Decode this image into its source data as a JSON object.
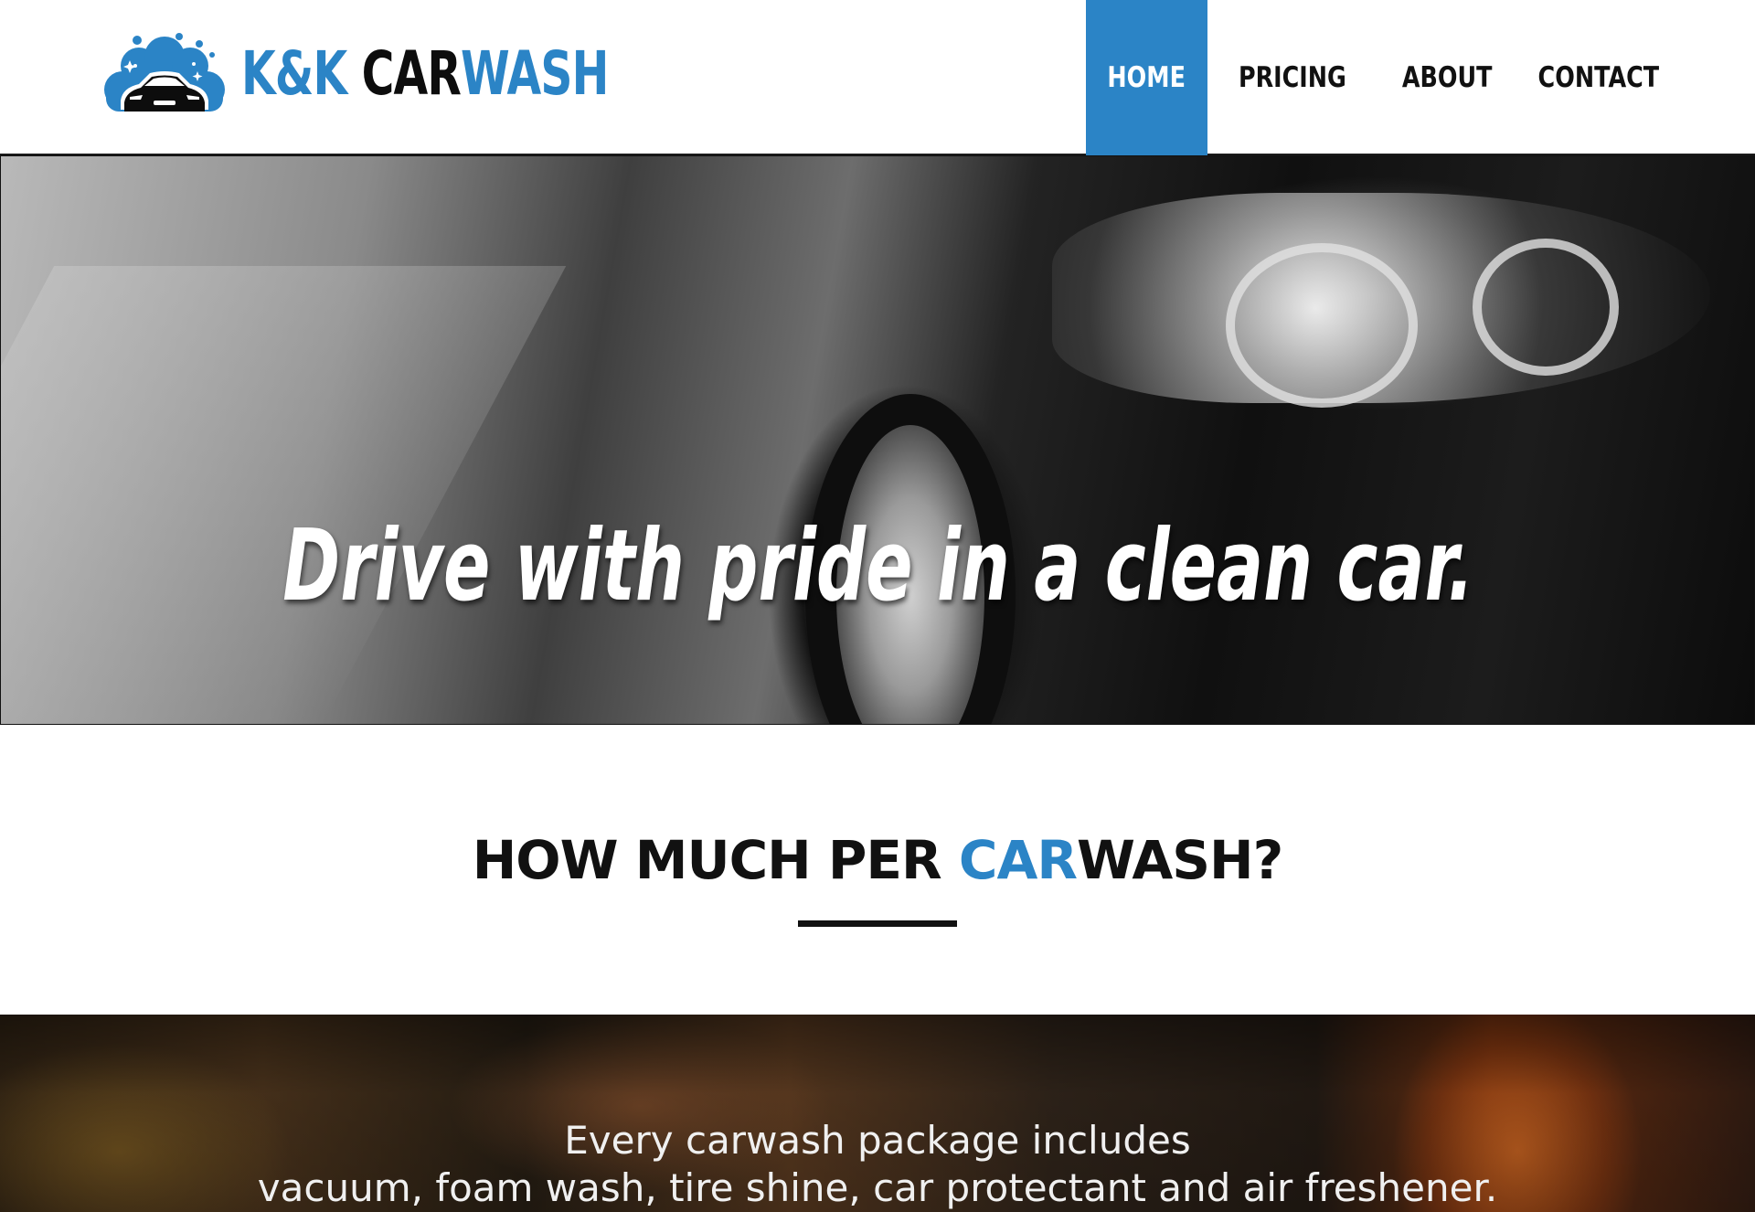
{
  "brand": {
    "name_part1": "K&K ",
    "name_part2": "CAR",
    "name_part3": "WASH",
    "accent_color": "#2b84c6",
    "logo_icon": "car-wash-bubbles-icon"
  },
  "nav": {
    "items": [
      {
        "label": "HOME",
        "active": true
      },
      {
        "label": "PRICING",
        "active": false
      },
      {
        "label": "ABOUT",
        "active": false
      },
      {
        "label": "CONTACT",
        "active": false
      }
    ]
  },
  "hero": {
    "headline": "Drive with pride in a clean car."
  },
  "pricing": {
    "title_part1": "HOW MUCH PER ",
    "title_part2": "CAR",
    "title_part3": "WASH?"
  },
  "banner": {
    "line1": "Every carwash package includes",
    "line2": "vacuum, foam wash, tire shine, car protectant and air freshener."
  }
}
